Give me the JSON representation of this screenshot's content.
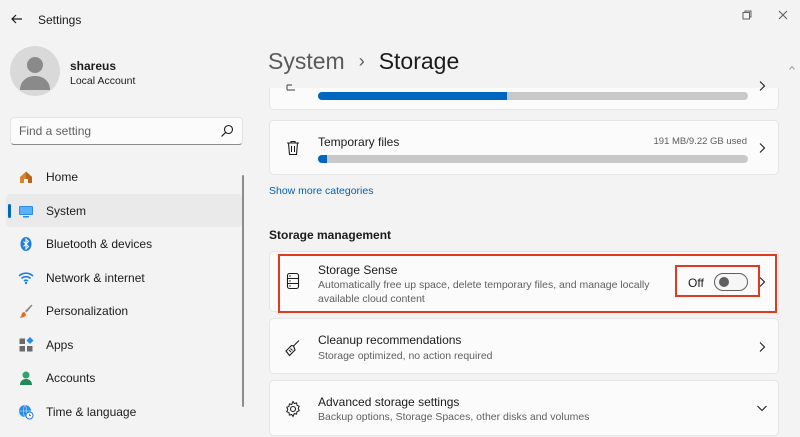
{
  "window": {
    "title": "Settings"
  },
  "profile": {
    "name": "shareus",
    "account_type": "Local Account"
  },
  "search": {
    "placeholder": "Find a setting"
  },
  "nav": {
    "items": [
      {
        "label": "Home",
        "icon": "home-icon"
      },
      {
        "label": "System",
        "icon": "system-icon",
        "active": true
      },
      {
        "label": "Bluetooth & devices",
        "icon": "bluetooth-icon"
      },
      {
        "label": "Network & internet",
        "icon": "wifi-icon"
      },
      {
        "label": "Personalization",
        "icon": "brush-icon"
      },
      {
        "label": "Apps",
        "icon": "apps-icon"
      },
      {
        "label": "Accounts",
        "icon": "accounts-icon"
      },
      {
        "label": "Time & language",
        "icon": "globe-clock-icon"
      }
    ]
  },
  "breadcrumb": {
    "parent": "System",
    "separator": "›",
    "current": "Storage"
  },
  "storage": {
    "partial_row": {
      "usage_fraction": 0.44
    },
    "temp_files": {
      "label": "Temporary files",
      "usage": "191 MB/9.22 GB used",
      "usage_fraction": 0.02
    },
    "show_more_link": "Show more categories"
  },
  "management": {
    "title": "Storage management",
    "storage_sense": {
      "title": "Storage Sense",
      "desc_line1": "Automatically free up space, delete temporary files, and manage locally",
      "desc_line2": "available cloud content",
      "toggle_state": "Off"
    },
    "cleanup": {
      "title": "Cleanup recommendations",
      "desc": "Storage optimized, no action required"
    },
    "advanced": {
      "title": "Advanced storage settings",
      "desc": "Backup options, Storage Spaces, other disks and volumes"
    }
  },
  "colors": {
    "accent": "#0067c0",
    "highlight": "#e03a22",
    "link": "#0060b0"
  }
}
